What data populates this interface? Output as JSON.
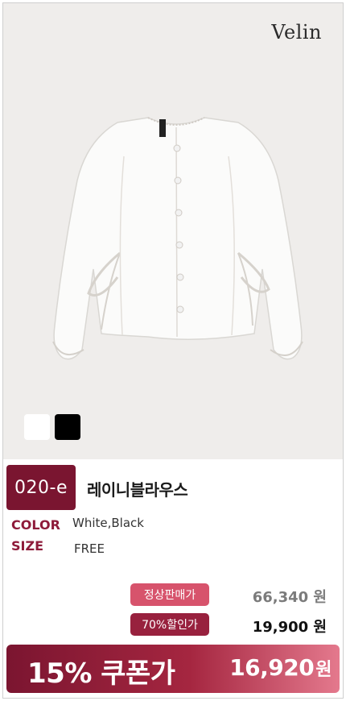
{
  "brand": {
    "logo_text": "Velin"
  },
  "product": {
    "code": "020-e",
    "name": "레이니블라우스",
    "colors": [
      "#ffffff",
      "#000000"
    ]
  },
  "specs": {
    "color_label": "COLOR",
    "color_value": "White,Black",
    "size_label": "SIZE",
    "size_value": "FREE"
  },
  "pricing": {
    "regular_label": "정상판매가",
    "regular_price": "66,340 원",
    "sale_label": "70%할인가",
    "sale_price": "19,900 원",
    "coupon_label": "15% 쿠폰가",
    "coupon_price": "16,920",
    "coupon_unit": "원"
  },
  "theme": {
    "accent": "#7a1530",
    "badge_pink": "#d7536c",
    "badge_wine": "#98213e",
    "photo_bg": "#efedeb"
  }
}
